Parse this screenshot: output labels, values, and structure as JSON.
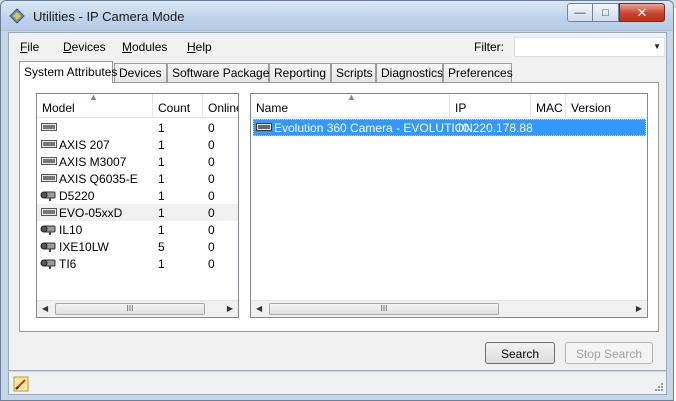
{
  "window": {
    "title": "Utilities - IP Camera Mode",
    "controls": {
      "minimize": "—",
      "maximize": "□",
      "close": "✕"
    }
  },
  "menu": {
    "items": [
      {
        "label": "File",
        "mnemonic": "F",
        "rest": "ile"
      },
      {
        "label": "Devices",
        "mnemonic": "D",
        "rest": "evices"
      },
      {
        "label": "Modules",
        "mnemonic": "M",
        "rest": "odules"
      },
      {
        "label": "Help",
        "mnemonic": "H",
        "rest": "elp"
      }
    ],
    "filter_label": "Filter:",
    "filter_value": ""
  },
  "tabs": [
    "System Attributes",
    "Devices",
    "Software Packages",
    "Reporting",
    "Scripts",
    "Diagnostics",
    "Preferences"
  ],
  "active_tab": "System Attributes",
  "model_list": {
    "columns": [
      "Model",
      "Count",
      "Online"
    ],
    "rows": [
      {
        "icon": "device-icon",
        "model": "",
        "count": "1",
        "online": "0"
      },
      {
        "icon": "device-icon",
        "model": "AXIS 207",
        "count": "1",
        "online": "0"
      },
      {
        "icon": "device-icon",
        "model": "AXIS M3007",
        "count": "1",
        "online": "0"
      },
      {
        "icon": "device-icon",
        "model": "AXIS Q6035-E",
        "count": "1",
        "online": "0"
      },
      {
        "icon": "camera-icon",
        "model": "D5220",
        "count": "1",
        "online": "0"
      },
      {
        "icon": "device-icon",
        "model": "EVO-05xxD",
        "count": "1",
        "online": "0"
      },
      {
        "icon": "camera-icon",
        "model": "IL10",
        "count": "1",
        "online": "0"
      },
      {
        "icon": "camera-icon",
        "model": "IXE10LW",
        "count": "5",
        "online": "0"
      },
      {
        "icon": "camera-icon",
        "model": "TI6",
        "count": "1",
        "online": "0"
      }
    ]
  },
  "device_list": {
    "columns": [
      "Name",
      "IP",
      "MAC",
      "Version"
    ],
    "rows": [
      {
        "icon": "device-icon",
        "name": "Evolution 360 Camera - EVOLUTION",
        "ip": "10.220.178.88",
        "mac": "",
        "version": ""
      }
    ]
  },
  "scroll": {
    "left": "◀",
    "right": "▶",
    "thumb": "III"
  },
  "buttons": {
    "search": "Search",
    "stop_search": "Stop Search"
  }
}
